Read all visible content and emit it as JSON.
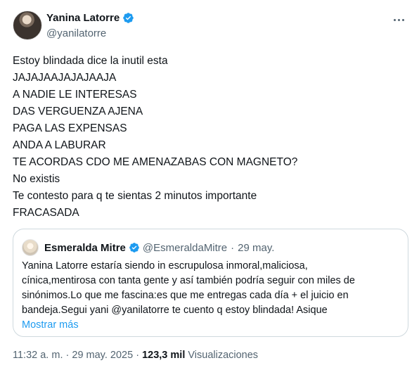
{
  "author": {
    "display_name": "Yanina Latorre",
    "handle": "@yanilatorre",
    "avatar_icon": "profile-photo"
  },
  "tweet_lines": [
    "Estoy blindada dice la inutil esta",
    "JAJAJAAJAJAJAAJA",
    "A NADIE LE INTERESAS",
    "DAS VERGUENZA AJENA",
    "PAGA LAS EXPENSAS",
    "ANDA A LABURAR",
    "TE ACORDAS CDO ME AMENAZABAS CON MAGNETO?",
    "No existis",
    "Te contesto para q te sientas 2 minutos importante",
    "FRACASADA"
  ],
  "quoted": {
    "display_name": "Esmeralda Mitre",
    "handle": "@EsmeraldaMitre",
    "separator": "·",
    "date": "29 may.",
    "lines": [
      "Yanina Latorre estaría  siendo in escrupulosa inmoral,maliciosa,",
      "cínica,mentirosa con tanta gente y así también podría seguir con miles de",
      "sinónimos.Lo que me fascina:es que me entregas cada día + el juicio en",
      "bandeja.Segui  yani  @yanilatorre te cuento q estoy  blindada! Asique"
    ],
    "show_more": "Mostrar más"
  },
  "meta": {
    "time": "11:32 a. m.",
    "dot1": "·",
    "date": "29 may. 2025",
    "dot2": "·",
    "views_count": "123,3 mil",
    "views_label": "Visualizaciones"
  },
  "colors": {
    "verified": "#1d9bf0",
    "link": "#1d9bf0",
    "muted": "#536471",
    "text": "#0f1419",
    "border": "#cfd9de"
  }
}
